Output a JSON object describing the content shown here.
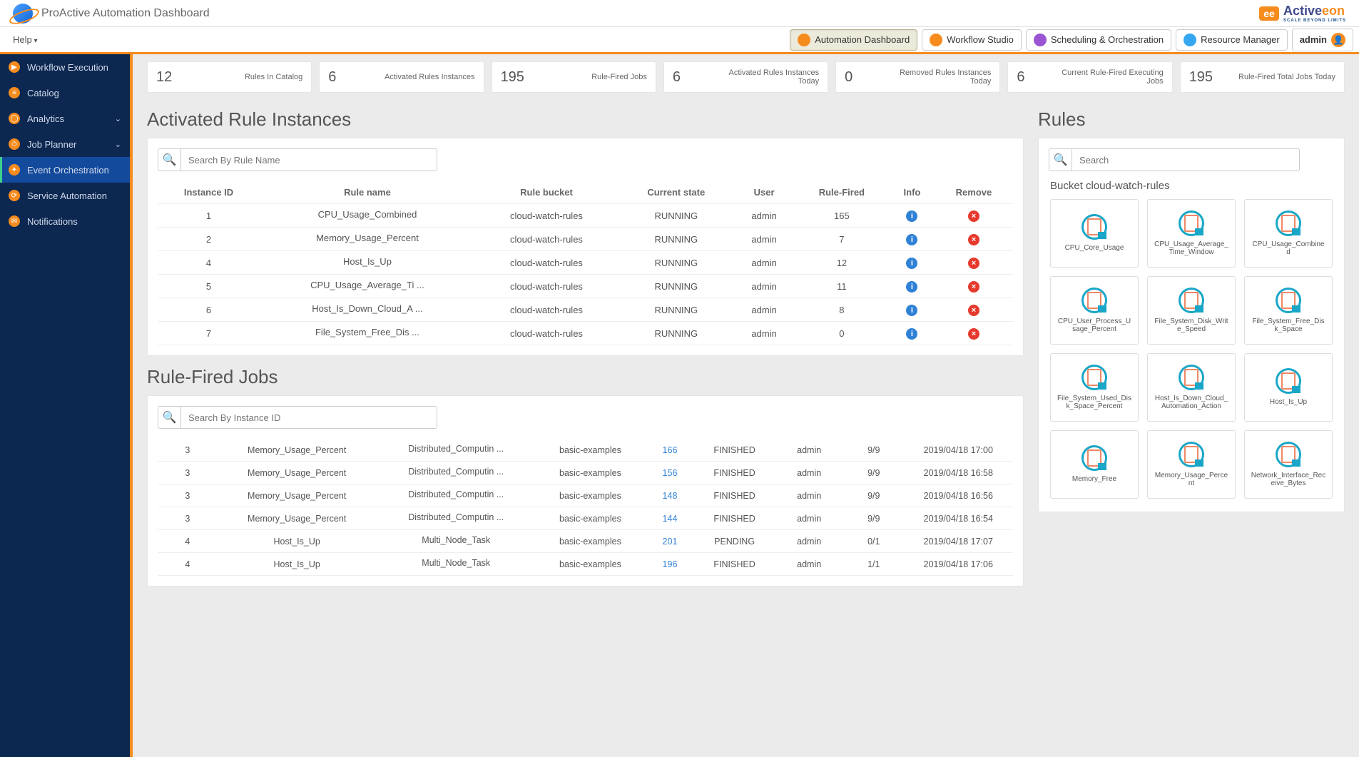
{
  "header": {
    "title": "ProActive Automation Dashboard",
    "brand": "Active",
    "brand_suffix": "eon",
    "tagline": "SCALE BEYOND LIMITS",
    "brand_badge": "ee"
  },
  "navstrip": {
    "help": "Help",
    "buttons": [
      {
        "label": "Automation Dashboard",
        "icon": "orange",
        "active": true
      },
      {
        "label": "Workflow Studio",
        "icon": "orange"
      },
      {
        "label": "Scheduling & Orchestration",
        "icon": "purple"
      },
      {
        "label": "Resource Manager",
        "icon": "blue"
      }
    ],
    "user": "admin"
  },
  "sidebar": {
    "items": [
      {
        "label": "Workflow Execution",
        "glyph": "▶"
      },
      {
        "label": "Catalog",
        "glyph": "≡"
      },
      {
        "label": "Analytics",
        "glyph": "◯",
        "chev": true
      },
      {
        "label": "Job Planner",
        "glyph": "⏱",
        "chev": true
      },
      {
        "label": "Event Orchestration",
        "glyph": "✦",
        "active": true
      },
      {
        "label": "Service Automation",
        "glyph": "⟳"
      },
      {
        "label": "Notifications",
        "glyph": "✉"
      }
    ]
  },
  "kpis": [
    {
      "num": "12",
      "lab": "Rules In Catalog"
    },
    {
      "num": "6",
      "lab": "Activated Rules Instances"
    },
    {
      "num": "195",
      "lab": "Rule-Fired Jobs"
    },
    {
      "num": "6",
      "lab": "Activated Rules Instances Today"
    },
    {
      "num": "0",
      "lab": "Removed Rules Instances Today"
    },
    {
      "num": "6",
      "lab": "Current Rule-Fired Executing Jobs"
    },
    {
      "num": "195",
      "lab": "Rule-Fired Total Jobs Today"
    }
  ],
  "instances": {
    "title": "Activated Rule Instances",
    "search_ph": "Search By Rule Name",
    "headers": [
      "Instance ID",
      "Rule name",
      "Rule bucket",
      "Current state",
      "User",
      "Rule-Fired",
      "Info",
      "Remove"
    ],
    "rows": [
      {
        "id": "1",
        "name": "CPU_Usage_Combined",
        "bucket": "cloud-watch-rules",
        "state": "RUNNING",
        "user": "admin",
        "fired": "165"
      },
      {
        "id": "2",
        "name": "Memory_Usage_Percent",
        "bucket": "cloud-watch-rules",
        "state": "RUNNING",
        "user": "admin",
        "fired": "7"
      },
      {
        "id": "4",
        "name": "Host_Is_Up",
        "bucket": "cloud-watch-rules",
        "state": "RUNNING",
        "user": "admin",
        "fired": "12"
      },
      {
        "id": "5",
        "name": "CPU_Usage_Average_Ti ...",
        "bucket": "cloud-watch-rules",
        "state": "RUNNING",
        "user": "admin",
        "fired": "11"
      },
      {
        "id": "6",
        "name": "Host_Is_Down_Cloud_A ...",
        "bucket": "cloud-watch-rules",
        "state": "RUNNING",
        "user": "admin",
        "fired": "8"
      },
      {
        "id": "7",
        "name": "File_System_Free_Dis ...",
        "bucket": "cloud-watch-rules",
        "state": "RUNNING",
        "user": "admin",
        "fired": "0"
      }
    ]
  },
  "jobs": {
    "title": "Rule-Fired Jobs",
    "search_ph": "Search By Instance ID",
    "rows": [
      {
        "iid": "3",
        "rule": "Memory_Usage_Percent",
        "wf": "Distributed_Computin ...",
        "bucket": "basic-examples",
        "job": "166",
        "state": "FINISHED",
        "user": "admin",
        "prog": "9/9",
        "ts": "2019/04/18 17:00"
      },
      {
        "iid": "3",
        "rule": "Memory_Usage_Percent",
        "wf": "Distributed_Computin ...",
        "bucket": "basic-examples",
        "job": "156",
        "state": "FINISHED",
        "user": "admin",
        "prog": "9/9",
        "ts": "2019/04/18 16:58"
      },
      {
        "iid": "3",
        "rule": "Memory_Usage_Percent",
        "wf": "Distributed_Computin ...",
        "bucket": "basic-examples",
        "job": "148",
        "state": "FINISHED",
        "user": "admin",
        "prog": "9/9",
        "ts": "2019/04/18 16:56"
      },
      {
        "iid": "3",
        "rule": "Memory_Usage_Percent",
        "wf": "Distributed_Computin ...",
        "bucket": "basic-examples",
        "job": "144",
        "state": "FINISHED",
        "user": "admin",
        "prog": "9/9",
        "ts": "2019/04/18 16:54"
      },
      {
        "iid": "4",
        "rule": "Host_Is_Up",
        "wf": "Multi_Node_Task",
        "bucket": "basic-examples",
        "job": "201",
        "state": "PENDING",
        "user": "admin",
        "prog": "0/1",
        "ts": "2019/04/18 17:07"
      },
      {
        "iid": "4",
        "rule": "Host_Is_Up",
        "wf": "Multi_Node_Task",
        "bucket": "basic-examples",
        "job": "196",
        "state": "FINISHED",
        "user": "admin",
        "prog": "1/1",
        "ts": "2019/04/18 17:06"
      }
    ]
  },
  "rules": {
    "title": "Rules",
    "search_ph": "Search",
    "bucket_title": "Bucket cloud-watch-rules",
    "cards": [
      "CPU_Core_Usage",
      "CPU_Usage_Average_Time_Window",
      "CPU_Usage_Combined",
      "CPU_User_Process_Usage_Percent",
      "File_System_Disk_Write_Speed",
      "File_System_Free_Disk_Space",
      "File_System_Used_Disk_Space_Percent",
      "Host_Is_Down_Cloud_Automation_Action",
      "Host_Is_Up",
      "Memory_Free",
      "Memory_Usage_Percent",
      "Network_Interface_Receive_Bytes"
    ]
  }
}
